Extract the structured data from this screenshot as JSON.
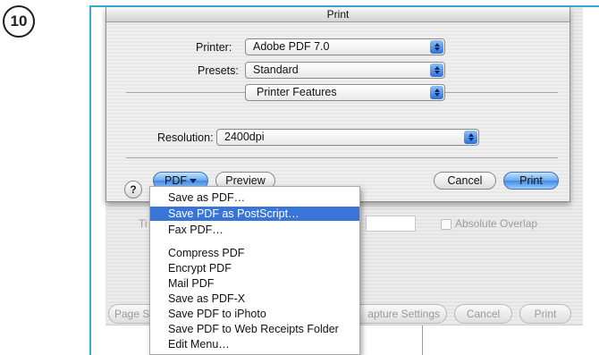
{
  "step": {
    "number": "10"
  },
  "background_window": {
    "label_ti": "Ti",
    "label_fragment": "",
    "absolute_overlap_label": "Absolute Overlap",
    "buttons": {
      "page_setup": "Page S",
      "capture_settings": "apture Settings",
      "cancel": "Cancel",
      "print": "Print"
    }
  },
  "print_dialog": {
    "title": "Print",
    "printer_label": "Printer:",
    "printer_value": "Adobe PDF 7.0",
    "presets_label": "Presets:",
    "presets_value": "Standard",
    "panel_value": "Printer Features",
    "resolution_label": "Resolution:",
    "resolution_value": "2400dpi",
    "help_label": "?",
    "pdf_button": "PDF",
    "preview_button": "Preview",
    "cancel_button": "Cancel",
    "print_button": "Print"
  },
  "pdf_menu": {
    "items": [
      "Save as PDF…",
      "Save PDF as PostScript…",
      "Fax PDF…",
      "Compress PDF",
      "Encrypt PDF",
      "Mail PDF",
      "Save as PDF-X",
      "Save PDF to iPhoto",
      "Save PDF to Web Receipts Folder",
      "Edit Menu…"
    ],
    "highlighted_index": 1
  },
  "colors": {
    "frame": "#3aa7d9",
    "highlight": "#3875d7",
    "aqua_blue": "#3d8ae8"
  }
}
